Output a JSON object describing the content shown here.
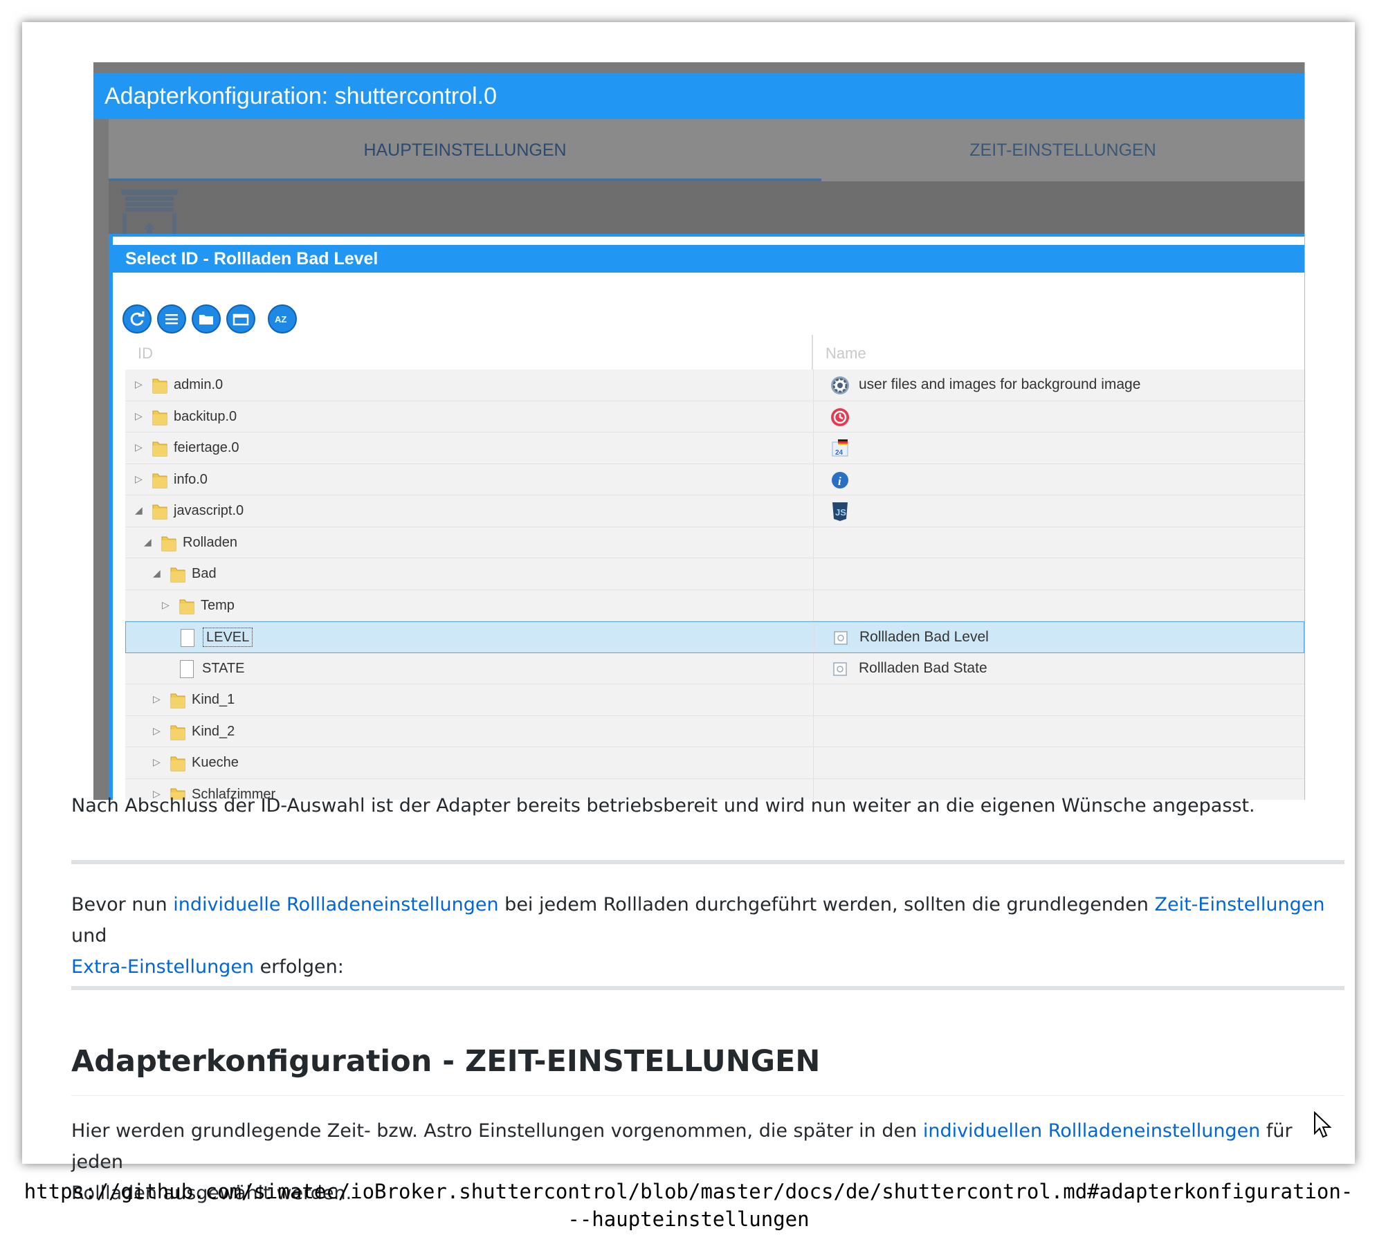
{
  "screenshot": {
    "window_title": "Adapterkonfiguration: shuttercontrol.0",
    "tabs": [
      {
        "label": "HAUPTEINSTELLUNGEN",
        "active": true
      },
      {
        "label": "ZEIT-EINSTELLUNGEN",
        "active": false
      }
    ],
    "dialog": {
      "title": "Select ID - Rollladen Bad Level",
      "toolbar_icons": [
        "refresh-icon",
        "list-icon",
        "folder-open-icon",
        "folder-closed-icon",
        "sort-az-icon"
      ],
      "columns": {
        "id": "ID",
        "name": "Name"
      },
      "rows": [
        {
          "label": "admin.0",
          "type": "folder",
          "expanded": false,
          "depth": 0,
          "name": "user files and images for background image",
          "name_icon": "gear-icon"
        },
        {
          "label": "backitup.0",
          "type": "folder",
          "expanded": false,
          "depth": 0,
          "name": "",
          "name_icon": "clock-icon"
        },
        {
          "label": "feiertage.0",
          "type": "folder",
          "expanded": false,
          "depth": 0,
          "name": "",
          "name_icon": "calendar-icon"
        },
        {
          "label": "info.0",
          "type": "folder",
          "expanded": false,
          "depth": 0,
          "name": "",
          "name_icon": "info-icon"
        },
        {
          "label": "javascript.0",
          "type": "folder",
          "expanded": true,
          "depth": 0,
          "name": "",
          "name_icon": "js-shield-icon"
        },
        {
          "label": "Rolladen",
          "type": "folder",
          "expanded": true,
          "depth": 1,
          "name": "",
          "name_icon": ""
        },
        {
          "label": "Bad",
          "type": "folder",
          "expanded": true,
          "depth": 2,
          "name": "",
          "name_icon": ""
        },
        {
          "label": "Temp",
          "type": "folder",
          "expanded": false,
          "depth": 3,
          "name": "",
          "name_icon": ""
        },
        {
          "label": "LEVEL",
          "type": "file",
          "selected": true,
          "depth": 3,
          "name": "Rollladen Bad Level",
          "name_icon": "state-icon"
        },
        {
          "label": "STATE",
          "type": "file",
          "depth": 3,
          "name": "Rollladen Bad State",
          "name_icon": "state-icon"
        },
        {
          "label": "Kind_1",
          "type": "folder",
          "expanded": false,
          "depth": 2,
          "name": "",
          "name_icon": ""
        },
        {
          "label": "Kind_2",
          "type": "folder",
          "expanded": false,
          "depth": 2,
          "name": "",
          "name_icon": ""
        },
        {
          "label": "Kueche",
          "type": "folder",
          "expanded": false,
          "depth": 2,
          "name": "",
          "name_icon": ""
        },
        {
          "label": "Schlafzimmer",
          "type": "folder",
          "expanded": false,
          "depth": 2,
          "name": "",
          "name_icon": ""
        }
      ]
    }
  },
  "article": {
    "p1": "Nach Abschluss der ID-Auswahl ist der Adapter bereits betriebsbereit und wird nun weiter an die eigenen Wünsche angepasst.",
    "p2": {
      "t1": "Bevor nun ",
      "link1": "individuelle Rollladeneinstellungen",
      "t2": " bei jedem Rollladen durchgeführt werden, sollten die grundlegenden ",
      "link2": "Zeit-Einstellungen",
      "t3": " und",
      "link3": "Extra-Einstellungen",
      "t4": " erfolgen:"
    },
    "heading": "Adapterkonfiguration - ZEIT-EINSTELLUNGEN",
    "p3": {
      "t1": "Hier werden grundlegende Zeit- bzw. Astro Einstellungen vorgenommen, die später in den ",
      "link1": "individuellen Rollladeneinstellungen",
      "t2": " für jeden",
      "t3": "Rollladen ausgewählt werden."
    }
  },
  "url_line1": "https://github.com/simatec/ioBroker.shuttercontrol/blob/master/docs/de/shuttercontrol.md#adapterkonfiguration-",
  "url_line2": "--haupteinstellungen",
  "colors": {
    "accent": "#2196f3",
    "link": "#0366d6",
    "selected_row": "#cfe8f7"
  }
}
